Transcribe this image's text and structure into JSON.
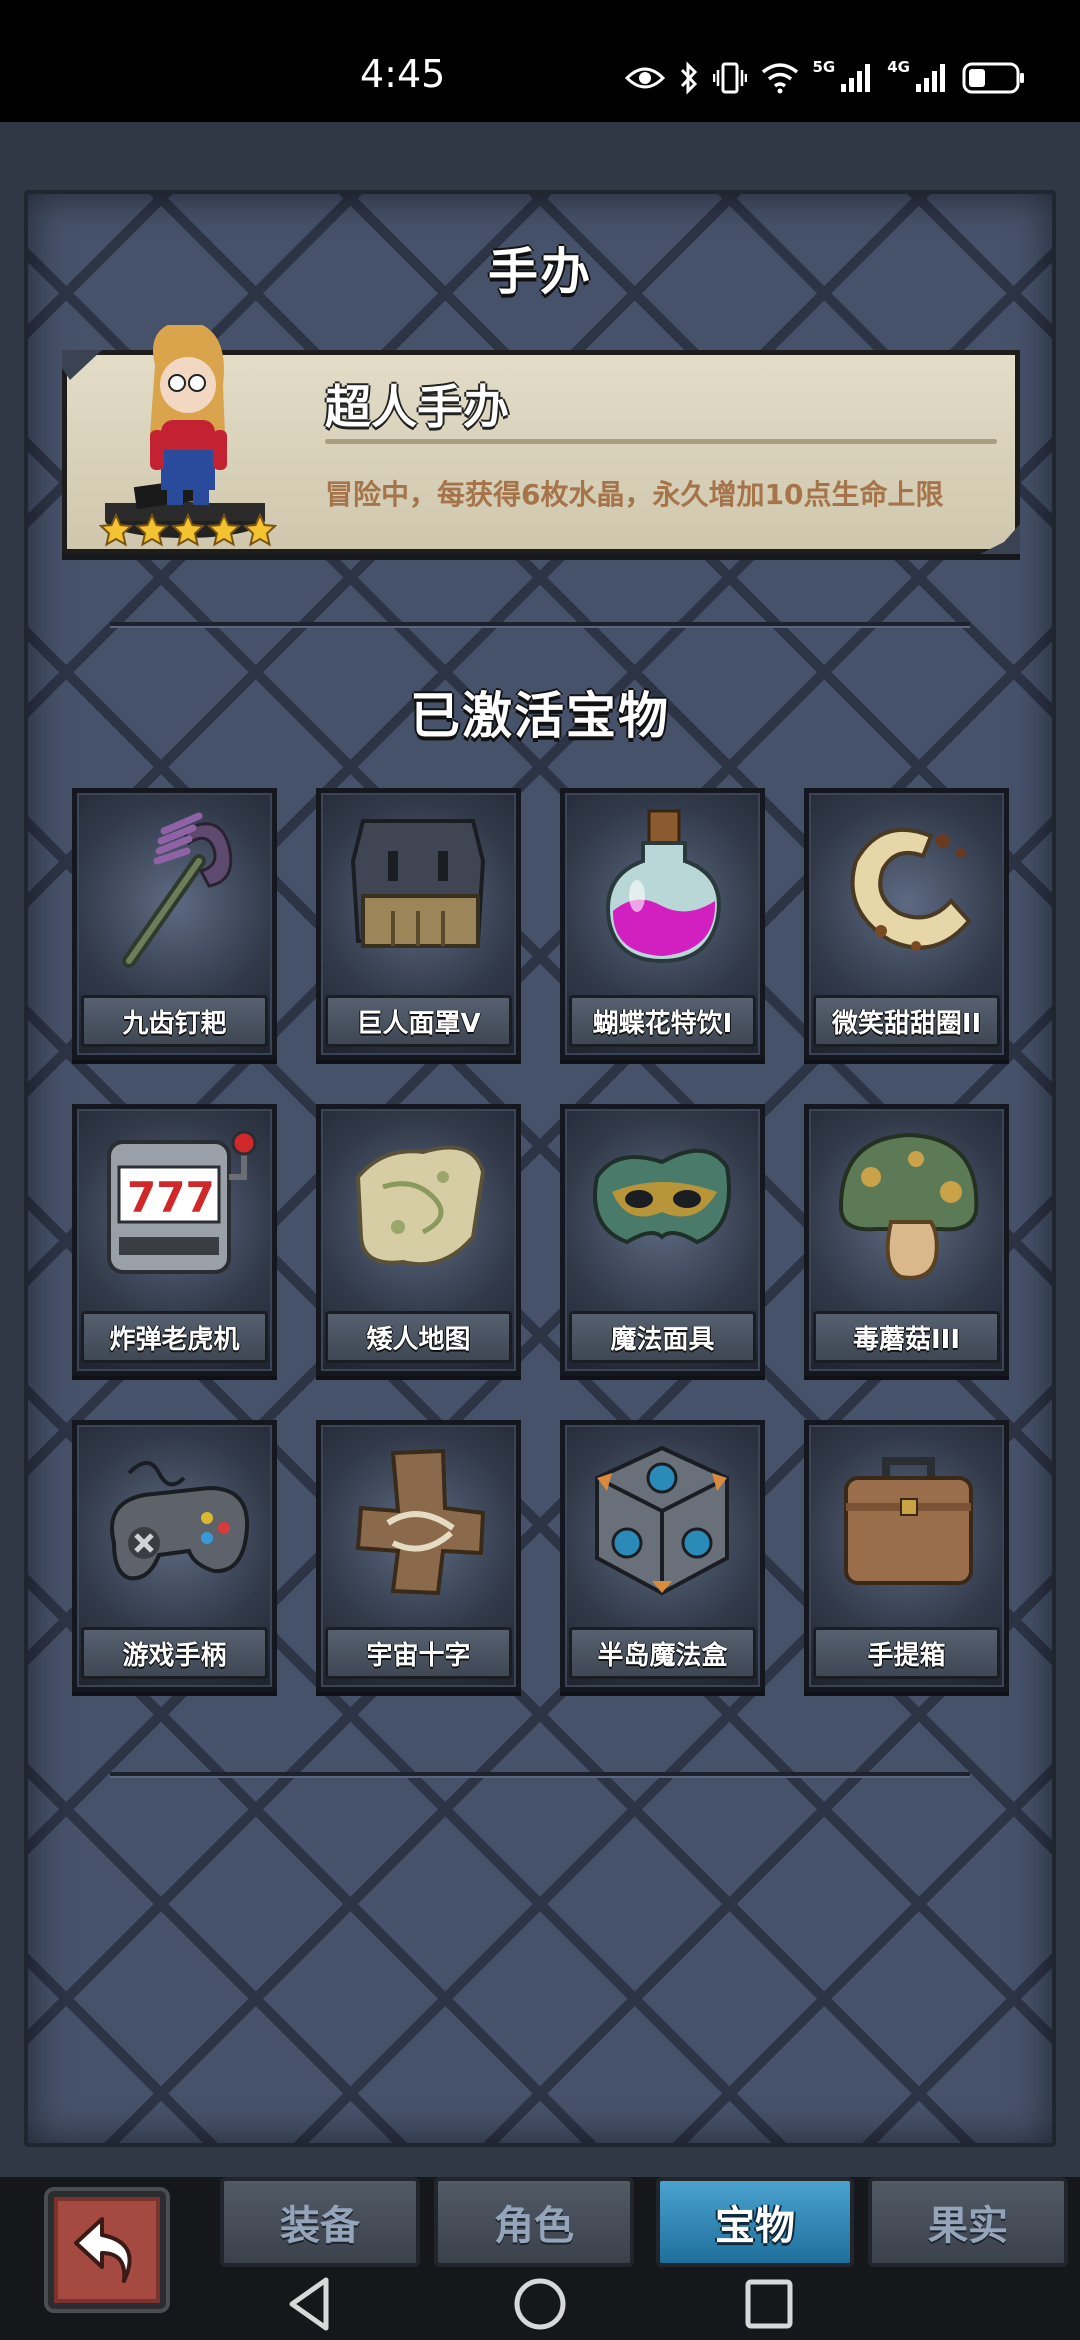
{
  "status_bar": {
    "time": "4:45",
    "network_5g": "5G",
    "network_4g": "4G",
    "icons": [
      "eye-icon",
      "bluetooth-icon",
      "vibrate-icon",
      "wifi-icon",
      "signal-icon",
      "signal-icon",
      "battery-icon"
    ]
  },
  "header": {
    "title": "手办"
  },
  "figure": {
    "name": "超人手办",
    "description": "冒险中，每获得6枚水晶，永久增加10点生命上限",
    "stars": 5
  },
  "treasures": {
    "title": "已激活宝物",
    "items": [
      {
        "label": "九齿钉耙",
        "icon": "rake-icon"
      },
      {
        "label": "巨人面罩V",
        "icon": "giant-mask-icon"
      },
      {
        "label": "蝴蝶花特饮I",
        "icon": "potion-icon"
      },
      {
        "label": "微笑甜甜圈II",
        "icon": "donut-icon"
      },
      {
        "label": "炸弹老虎机",
        "icon": "slot-machine-icon"
      },
      {
        "label": "矮人地图",
        "icon": "map-icon"
      },
      {
        "label": "魔法面具",
        "icon": "magic-mask-icon"
      },
      {
        "label": "毒蘑菇III",
        "icon": "mushroom-icon"
      },
      {
        "label": "游戏手柄",
        "icon": "gamepad-icon"
      },
      {
        "label": "宇宙十字",
        "icon": "cross-icon"
      },
      {
        "label": "半岛魔法盒",
        "icon": "magic-box-icon"
      },
      {
        "label": "手提箱",
        "icon": "suitcase-icon"
      }
    ]
  },
  "tabs": [
    {
      "label": "装备",
      "active": false
    },
    {
      "label": "角色",
      "active": false
    },
    {
      "label": "宝物",
      "active": true
    },
    {
      "label": "果实",
      "active": false
    }
  ],
  "colors": {
    "tab_active": "#2b86b8",
    "panel": "#46526a",
    "card": "#d8d1b9",
    "desc": "#a6744a"
  }
}
